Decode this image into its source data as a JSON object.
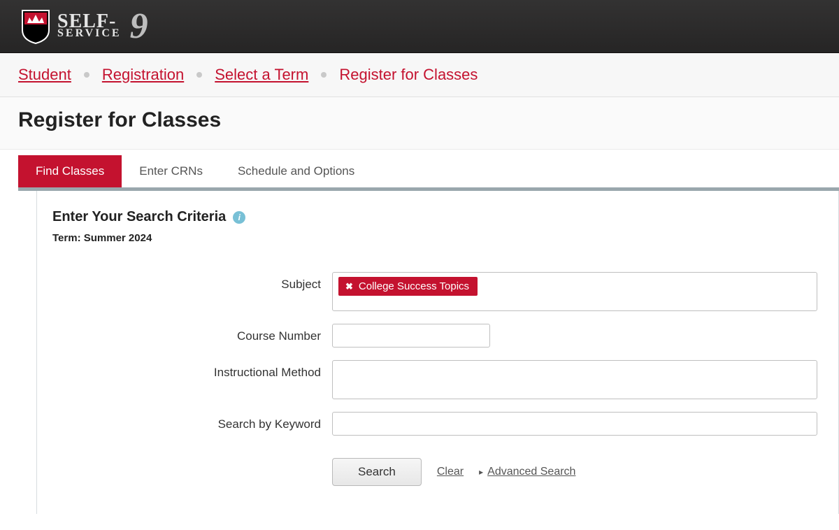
{
  "logo": {
    "main": "SELF-",
    "sub": "SERVICE",
    "suffix": "9"
  },
  "breadcrumb": {
    "items": [
      {
        "label": "Student"
      },
      {
        "label": "Registration"
      },
      {
        "label": "Select a Term"
      }
    ],
    "current": "Register for Classes"
  },
  "page_title": "Register for Classes",
  "tabs": [
    {
      "label": "Find Classes",
      "active": true
    },
    {
      "label": "Enter CRNs",
      "active": false
    },
    {
      "label": "Schedule and Options",
      "active": false
    }
  ],
  "criteria": {
    "heading": "Enter Your Search Criteria",
    "term_label": "Term:",
    "term_value": "Summer 2024"
  },
  "form": {
    "subject": {
      "label": "Subject",
      "tag": "College Success Topics"
    },
    "course_number": {
      "label": "Course Number",
      "value": ""
    },
    "instructional_method": {
      "label": "Instructional Method"
    },
    "keyword": {
      "label": "Search by Keyword",
      "value": ""
    }
  },
  "buttons": {
    "search": "Search",
    "clear": "Clear",
    "advanced": "Advanced Search"
  }
}
